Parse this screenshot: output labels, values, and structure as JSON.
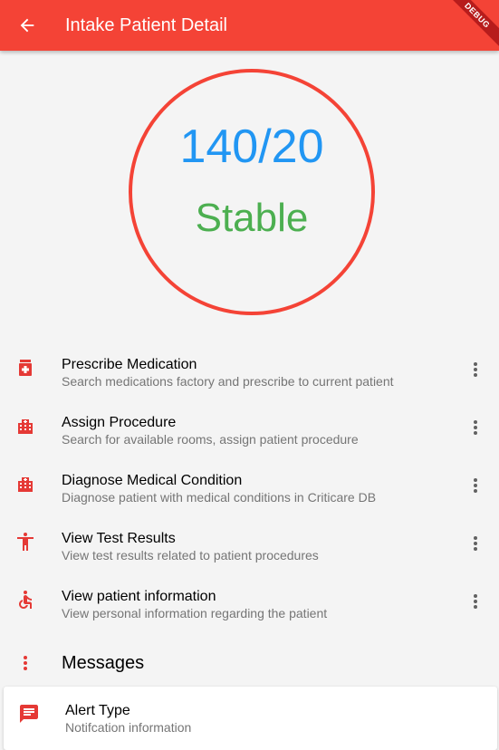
{
  "colors": {
    "appbar": "#f44336",
    "accent_icon": "#e53935",
    "vital_value": "#2196f3",
    "vital_status": "#4caf50",
    "circle_border": "#f44336"
  },
  "appbar": {
    "title": "Intake Patient Detail",
    "back_icon": "arrow-back-icon",
    "debug_label": "DEBUG"
  },
  "vitals": {
    "value": "140/20",
    "status": "Stable"
  },
  "actions": [
    {
      "icon": "medication-icon",
      "title": "Prescribe Medication",
      "subtitle": "Search medications factory and prescribe to current patient",
      "more_icon": "more-vert-icon"
    },
    {
      "icon": "hospital-building-icon",
      "title": "Assign Procedure",
      "subtitle": "Search for available rooms, assign patient procedure",
      "more_icon": "more-vert-icon"
    },
    {
      "icon": "hospital-building-icon",
      "title": "Diagnose Medical Condition",
      "subtitle": "Diagnose patient with medical conditions in Criticare DB",
      "more_icon": "more-vert-icon"
    },
    {
      "icon": "accessibility-person-icon",
      "title": "View Test Results",
      "subtitle": "View test results related to patient procedures",
      "more_icon": "more-vert-icon"
    },
    {
      "icon": "wheelchair-icon",
      "title": "View patient information",
      "subtitle": "View personal information regarding the patient",
      "more_icon": "more-vert-icon"
    }
  ],
  "messages": {
    "header_icon": "more-vert-icon",
    "title": "Messages",
    "items": [
      {
        "icon": "message-icon",
        "title": "Alert Type",
        "subtitle": "Notifcation information"
      }
    ]
  }
}
